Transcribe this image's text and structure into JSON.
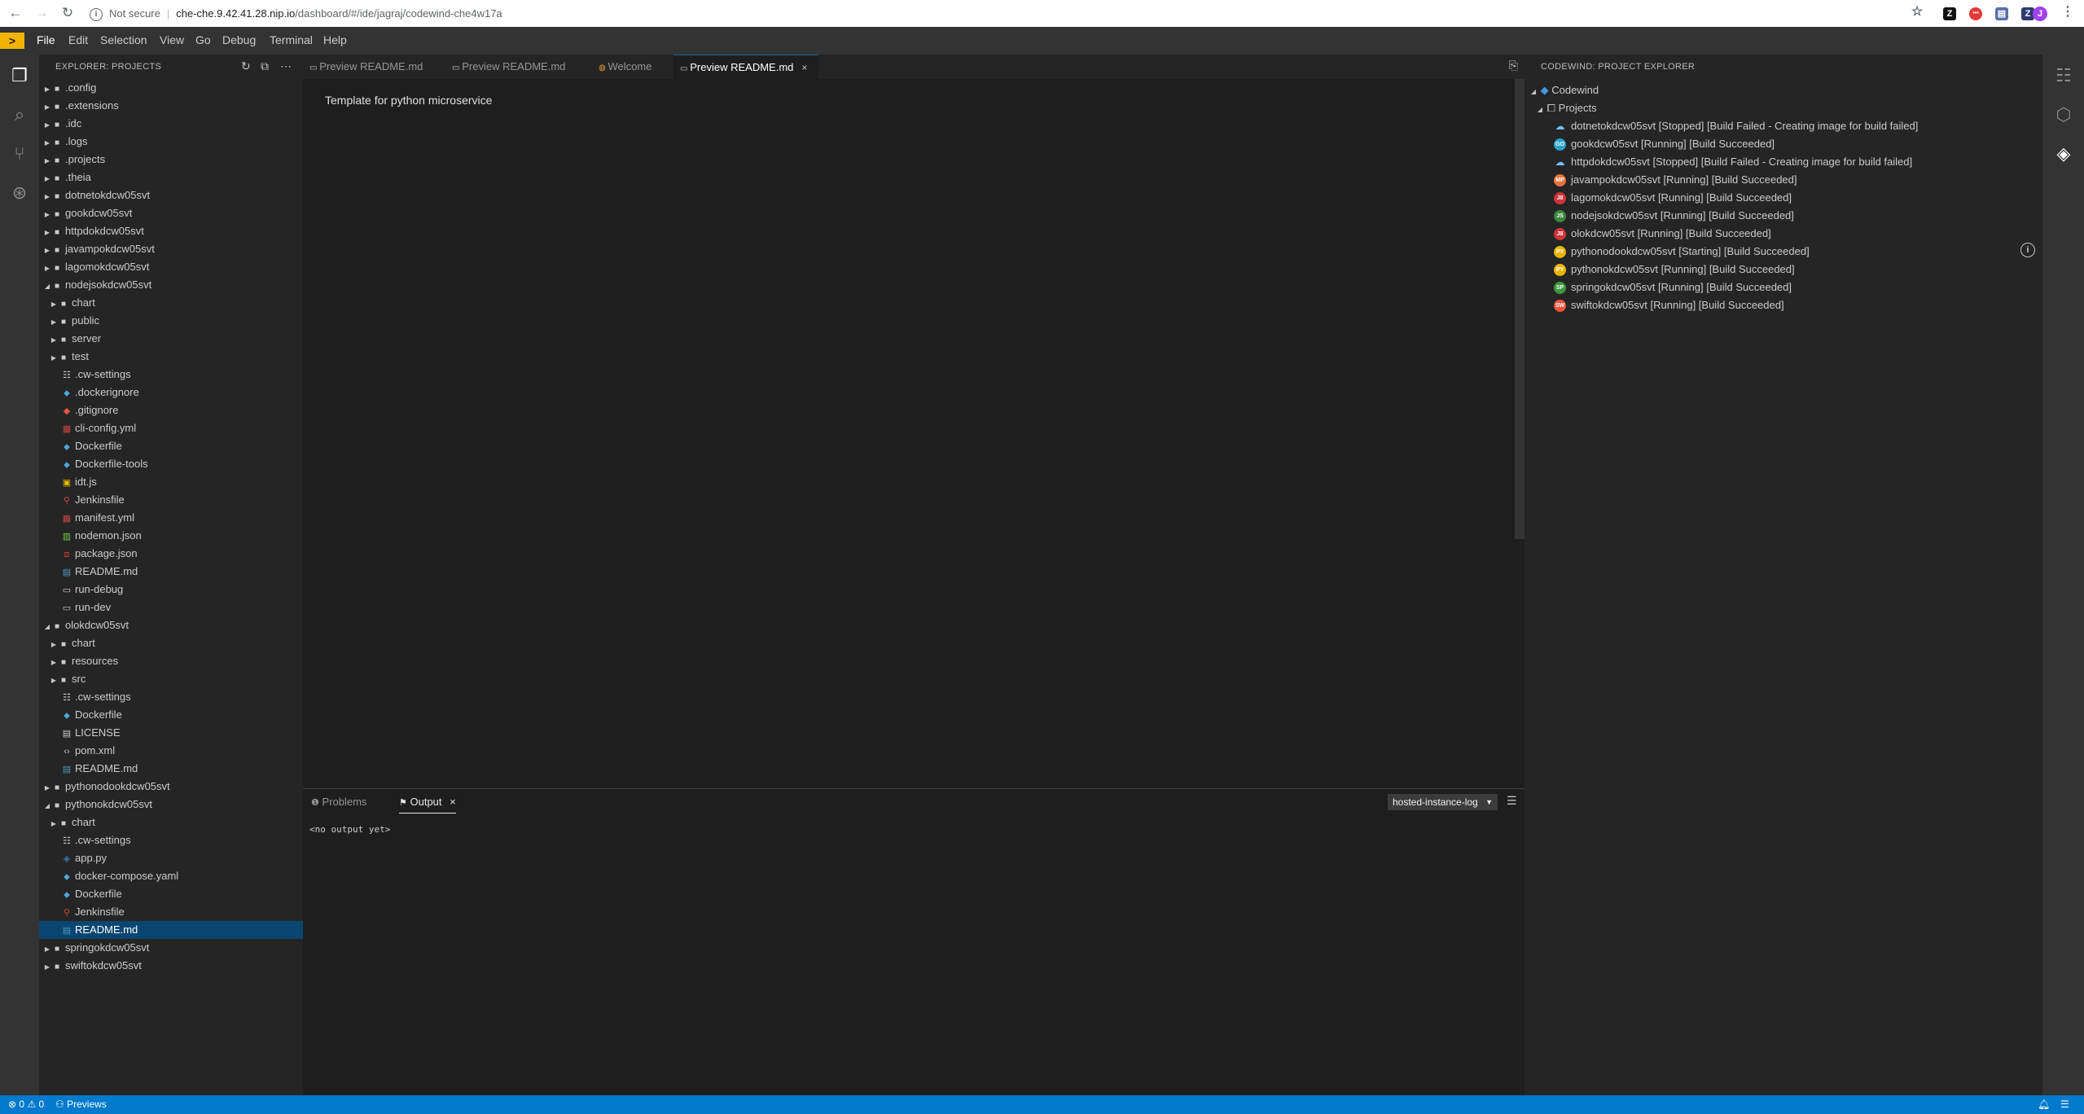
{
  "browser": {
    "security": "Not secure",
    "url_host": "che-che.9.42.41.28.nip.io",
    "url_path": "/dashboard/#/ide/jagraj/codewind-che4w17a",
    "profile_initial": "J"
  },
  "menu": [
    "File",
    "Edit",
    "Selection",
    "View",
    "Go",
    "Debug",
    "Terminal",
    "Help"
  ],
  "explorer": {
    "title": "EXPLORER: PROJECTS",
    "rows": [
      {
        "label": ".config",
        "depth": 0,
        "kind": "folder",
        "open": false
      },
      {
        "label": ".extensions",
        "depth": 0,
        "kind": "folder",
        "open": false
      },
      {
        "label": ".idc",
        "depth": 0,
        "kind": "folder",
        "open": false
      },
      {
        "label": ".logs",
        "depth": 0,
        "kind": "folder",
        "open": false
      },
      {
        "label": ".projects",
        "depth": 0,
        "kind": "folder",
        "open": false
      },
      {
        "label": ".theia",
        "depth": 0,
        "kind": "folder",
        "open": false
      },
      {
        "label": "dotnetokdcw05svt",
        "depth": 0,
        "kind": "folder",
        "open": false
      },
      {
        "label": "gookdcw05svt",
        "depth": 0,
        "kind": "folder",
        "open": false
      },
      {
        "label": "httpdokdcw05svt",
        "depth": 0,
        "kind": "folder",
        "open": false
      },
      {
        "label": "javampokdcw05svt",
        "depth": 0,
        "kind": "folder",
        "open": false
      },
      {
        "label": "lagomokdcw05svt",
        "depth": 0,
        "kind": "folder",
        "open": false
      },
      {
        "label": "nodejsokdcw05svt",
        "depth": 0,
        "kind": "folder",
        "open": true
      },
      {
        "label": "chart",
        "depth": 1,
        "kind": "folder",
        "open": false
      },
      {
        "label": "public",
        "depth": 1,
        "kind": "folder",
        "open": false
      },
      {
        "label": "server",
        "depth": 1,
        "kind": "folder",
        "open": false
      },
      {
        "label": "test",
        "depth": 1,
        "kind": "folder",
        "open": false
      },
      {
        "label": ".cw-settings",
        "depth": 1,
        "kind": "settings"
      },
      {
        "label": ".dockerignore",
        "depth": 1,
        "kind": "docker"
      },
      {
        "label": ".gitignore",
        "depth": 1,
        "kind": "git"
      },
      {
        "label": "cli-config.yml",
        "depth": 1,
        "kind": "yml"
      },
      {
        "label": "Dockerfile",
        "depth": 1,
        "kind": "docker"
      },
      {
        "label": "Dockerfile-tools",
        "depth": 1,
        "kind": "docker"
      },
      {
        "label": "idt.js",
        "depth": 1,
        "kind": "js"
      },
      {
        "label": "Jenkinsfile",
        "depth": 1,
        "kind": "jenkins"
      },
      {
        "label": "manifest.yml",
        "depth": 1,
        "kind": "yml"
      },
      {
        "label": "nodemon.json",
        "depth": 1,
        "kind": "nodemon"
      },
      {
        "label": "package.json",
        "depth": 1,
        "kind": "npm"
      },
      {
        "label": "README.md",
        "depth": 1,
        "kind": "md"
      },
      {
        "label": "run-debug",
        "depth": 1,
        "kind": "file"
      },
      {
        "label": "run-dev",
        "depth": 1,
        "kind": "file"
      },
      {
        "label": "olokdcw05svt",
        "depth": 0,
        "kind": "folder",
        "open": true
      },
      {
        "label": "chart",
        "depth": 1,
        "kind": "folder",
        "open": false
      },
      {
        "label": "resources",
        "depth": 1,
        "kind": "folder",
        "open": false
      },
      {
        "label": "src",
        "depth": 1,
        "kind": "folder",
        "open": false
      },
      {
        "label": ".cw-settings",
        "depth": 1,
        "kind": "settings"
      },
      {
        "label": "Dockerfile",
        "depth": 1,
        "kind": "docker"
      },
      {
        "label": "LICENSE",
        "depth": 1,
        "kind": "license"
      },
      {
        "label": "pom.xml",
        "depth": 1,
        "kind": "xml"
      },
      {
        "label": "README.md",
        "depth": 1,
        "kind": "md"
      },
      {
        "label": "pythonodookdcw05svt",
        "depth": 0,
        "kind": "folder",
        "open": false
      },
      {
        "label": "pythonokdcw05svt",
        "depth": 0,
        "kind": "folder",
        "open": true
      },
      {
        "label": "chart",
        "depth": 1,
        "kind": "folder",
        "open": false
      },
      {
        "label": ".cw-settings",
        "depth": 1,
        "kind": "settings"
      },
      {
        "label": "app.py",
        "depth": 1,
        "kind": "py"
      },
      {
        "label": "docker-compose.yaml",
        "depth": 1,
        "kind": "docker"
      },
      {
        "label": "Dockerfile",
        "depth": 1,
        "kind": "docker"
      },
      {
        "label": "Jenkinsfile",
        "depth": 1,
        "kind": "jenkins"
      },
      {
        "label": "README.md",
        "depth": 1,
        "kind": "md",
        "selected": true
      },
      {
        "label": "springokdcw05svt",
        "depth": 0,
        "kind": "folder",
        "open": false
      },
      {
        "label": "swiftokdcw05svt",
        "depth": 0,
        "kind": "folder",
        "open": false
      }
    ]
  },
  "tabs": [
    {
      "label": "Preview README.md",
      "active": false
    },
    {
      "label": "Preview README.md",
      "active": false
    },
    {
      "label": "Welcome",
      "active": false
    },
    {
      "label": "Preview README.md",
      "active": true
    }
  ],
  "editor": {
    "preview_text": "Template for python microservice"
  },
  "panel": {
    "tabs": [
      {
        "label": "Problems",
        "active": false
      },
      {
        "label": "Output",
        "active": true
      }
    ],
    "channel": "hosted-instance-log",
    "output": "<no output yet>"
  },
  "codewind": {
    "title": "CODEWIND: PROJECT EXPLORER",
    "root": "Codewind",
    "group": "Projects",
    "projects": [
      {
        "label": "dotnetokdcw05svt [Stopped] [Build Failed - Creating image for build failed]",
        "badge": "",
        "color": ""
      },
      {
        "label": "gookdcw05svt [Running] [Build Succeeded]",
        "badge": "GO",
        "color": "#29a3c9"
      },
      {
        "label": "httpdokdcw05svt [Stopped] [Build Failed - Creating image for build failed]",
        "badge": "",
        "color": ""
      },
      {
        "label": "javampokdcw05svt [Running] [Build Succeeded]",
        "badge": "MP",
        "color": "#e8743b"
      },
      {
        "label": "lagomokdcw05svt [Running] [Build Succeeded]",
        "badge": "J8",
        "color": "#d13438"
      },
      {
        "label": "nodejsokdcw05svt [Running] [Build Succeeded]",
        "badge": "JS",
        "color": "#3c873a"
      },
      {
        "label": "olokdcw05svt [Running] [Build Succeeded]",
        "badge": "J8",
        "color": "#d13438"
      },
      {
        "label": "pythonodookdcw05svt [Starting] [Build Succeeded]",
        "badge": "PY",
        "color": "#e8b400"
      },
      {
        "label": "pythonokdcw05svt [Running] [Build Succeeded]",
        "badge": "PY",
        "color": "#e8b400"
      },
      {
        "label": "springokdcw05svt [Running] [Build Succeeded]",
        "badge": "SP",
        "color": "#3c9a3c"
      },
      {
        "label": "swiftokdcw05svt [Running] [Build Succeeded]",
        "badge": "SW",
        "color": "#e8543b"
      }
    ]
  },
  "statusbar": {
    "errors": "0",
    "warnings": "0",
    "previews": "Previews"
  }
}
